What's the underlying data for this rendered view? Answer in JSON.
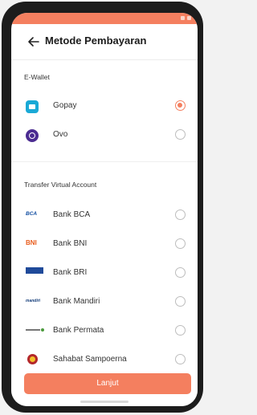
{
  "header": {
    "title": "Metode Pembayaran"
  },
  "sections": {
    "ewallet": "E-Wallet",
    "virtual_account": "Transfer Virtual Account"
  },
  "ewallets": [
    {
      "name": "Gopay",
      "selected": true
    },
    {
      "name": "Ovo",
      "selected": false
    }
  ],
  "banks": [
    {
      "name": "Bank BCA",
      "logo_text": "BCA",
      "selected": false
    },
    {
      "name": "Bank BNI",
      "logo_text": "BNI",
      "selected": false
    },
    {
      "name": "Bank BRI",
      "selected": false
    },
    {
      "name": "Bank Mandiri",
      "logo_text": "mandiri",
      "selected": false
    },
    {
      "name": "Bank Permata",
      "selected": false
    },
    {
      "name": "Sahabat Sampoerna",
      "selected": false
    }
  ],
  "footer": {
    "button_label": "Lanjut"
  },
  "colors": {
    "accent": "#f47f5f"
  }
}
